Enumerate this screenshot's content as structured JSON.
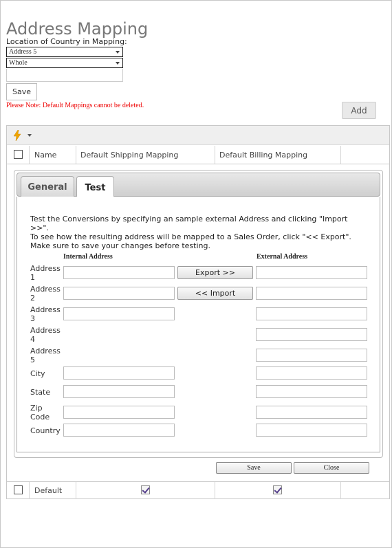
{
  "page": {
    "title": "Address Mapping",
    "location_label": "Location of Country in Mapping:",
    "location_select_1": "Address 5",
    "location_select_2": "Whole",
    "save_label": "Save",
    "note": "Please Note: Default Mappings cannot be deleted.",
    "add_label": "Add"
  },
  "grid": {
    "toolbar_icon": "lightning-icon",
    "columns": [
      "Name",
      "Default Shipping Mapping",
      "Default Billing Mapping"
    ],
    "rows": [
      {
        "name": "Default",
        "default_shipping": true,
        "default_billing": true
      }
    ]
  },
  "detail": {
    "tabs": [
      "General",
      "Test"
    ],
    "active_tab": "Test",
    "instructions": "Test the Conversions by specifying an sample external Address and clicking \"Import >>\".\nTo see how the resulting address will be mapped to a Sales Order, click \"<< Export\". Make sure to save your changes before testing.",
    "internal_header": "Internal Address",
    "external_header": "External Address",
    "fields": [
      "Address 1",
      "Address 2",
      "Address 3",
      "Address 4",
      "Address 5",
      "City",
      "State",
      "Zip Code",
      "Country"
    ],
    "export_label": "Export >>",
    "import_label": "<< Import",
    "save_label": "Save",
    "close_label": "Close"
  }
}
